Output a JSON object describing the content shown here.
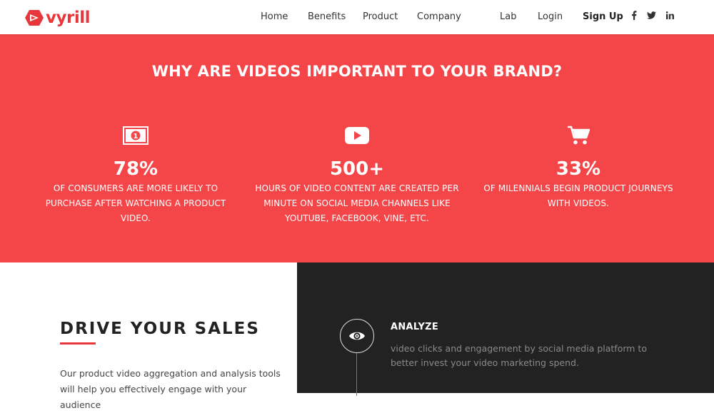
{
  "brand": {
    "name": "vyrill",
    "accent": "#e8373c"
  },
  "nav": {
    "links": [
      "Home",
      "Benefits",
      "Product",
      "Company",
      "Lab",
      "Login"
    ],
    "signup": "Sign Up",
    "social": [
      "f",
      "t",
      "in"
    ]
  },
  "hero": {
    "title": "WHY ARE VIDEOS IMPORTANT TO YOUR BRAND?",
    "background": "#f44649",
    "stats": [
      {
        "icon": "money-icon",
        "value": "78%",
        "desc": "OF CONSUMERS ARE MORE LIKELY TO PURCHASE AFTER WATCHING A PRODUCT VIDEO."
      },
      {
        "icon": "play-icon",
        "value": "500+",
        "desc": "HOURS OF VIDEO CONTENT ARE CREATED PER MINUTE ON SOCIAL MEDIA CHANNELS LIKE YOUTUBE, FACEBOOK, VINE, ETC."
      },
      {
        "icon": "cart-icon",
        "value": "33%",
        "desc": "OF MILENNIALS BEGIN PRODUCT JOURNEYS WITH VIDEOS."
      }
    ]
  },
  "sales": {
    "title": "DRIVE YOUR SALES",
    "body": "Our product video aggregation and analysis tools will help you effectively engage with your audience"
  },
  "features": [
    {
      "icon": "eye-icon",
      "title": "ANALYZE",
      "desc": "video clicks and engagement by social media platform to better invest your video marketing spend."
    }
  ]
}
